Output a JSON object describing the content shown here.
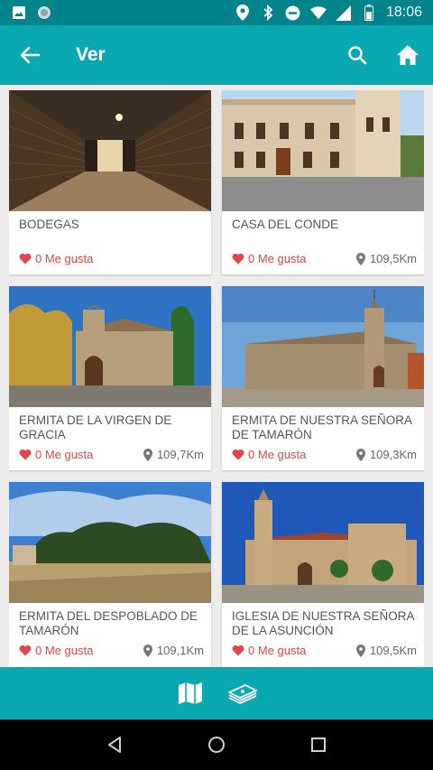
{
  "status_bar": {
    "time": "18:06"
  },
  "app_bar": {
    "title": "Ver"
  },
  "cards": [
    {
      "name": "BODEGAS",
      "likes": "0 Me gusta",
      "distance": ""
    },
    {
      "name": "CASA DEL CONDE",
      "likes": "0 Me gusta",
      "distance": "109,5Km"
    },
    {
      "name": "ERMITA DE LA VIRGEN DE GRACIA",
      "likes": "0 Me gusta",
      "distance": "109,7Km"
    },
    {
      "name": "ERMITA DE NUESTRA SEÑORA DE TAMARÓN",
      "likes": "0 Me gusta",
      "distance": "109,3Km"
    },
    {
      "name": "ERMITA DEL DESPOBLADO DE TAMARÓN",
      "likes": "0 Me gusta",
      "distance": "109,1Km"
    },
    {
      "name": "IGLESIA DE NUESTRA SEÑORA DE LA ASUNCIÓN",
      "likes": "0 Me gusta",
      "distance": "109,5Km"
    }
  ],
  "colors": {
    "primary": "#0aa9b1",
    "status": "#00838a",
    "like": "#e0464b"
  }
}
